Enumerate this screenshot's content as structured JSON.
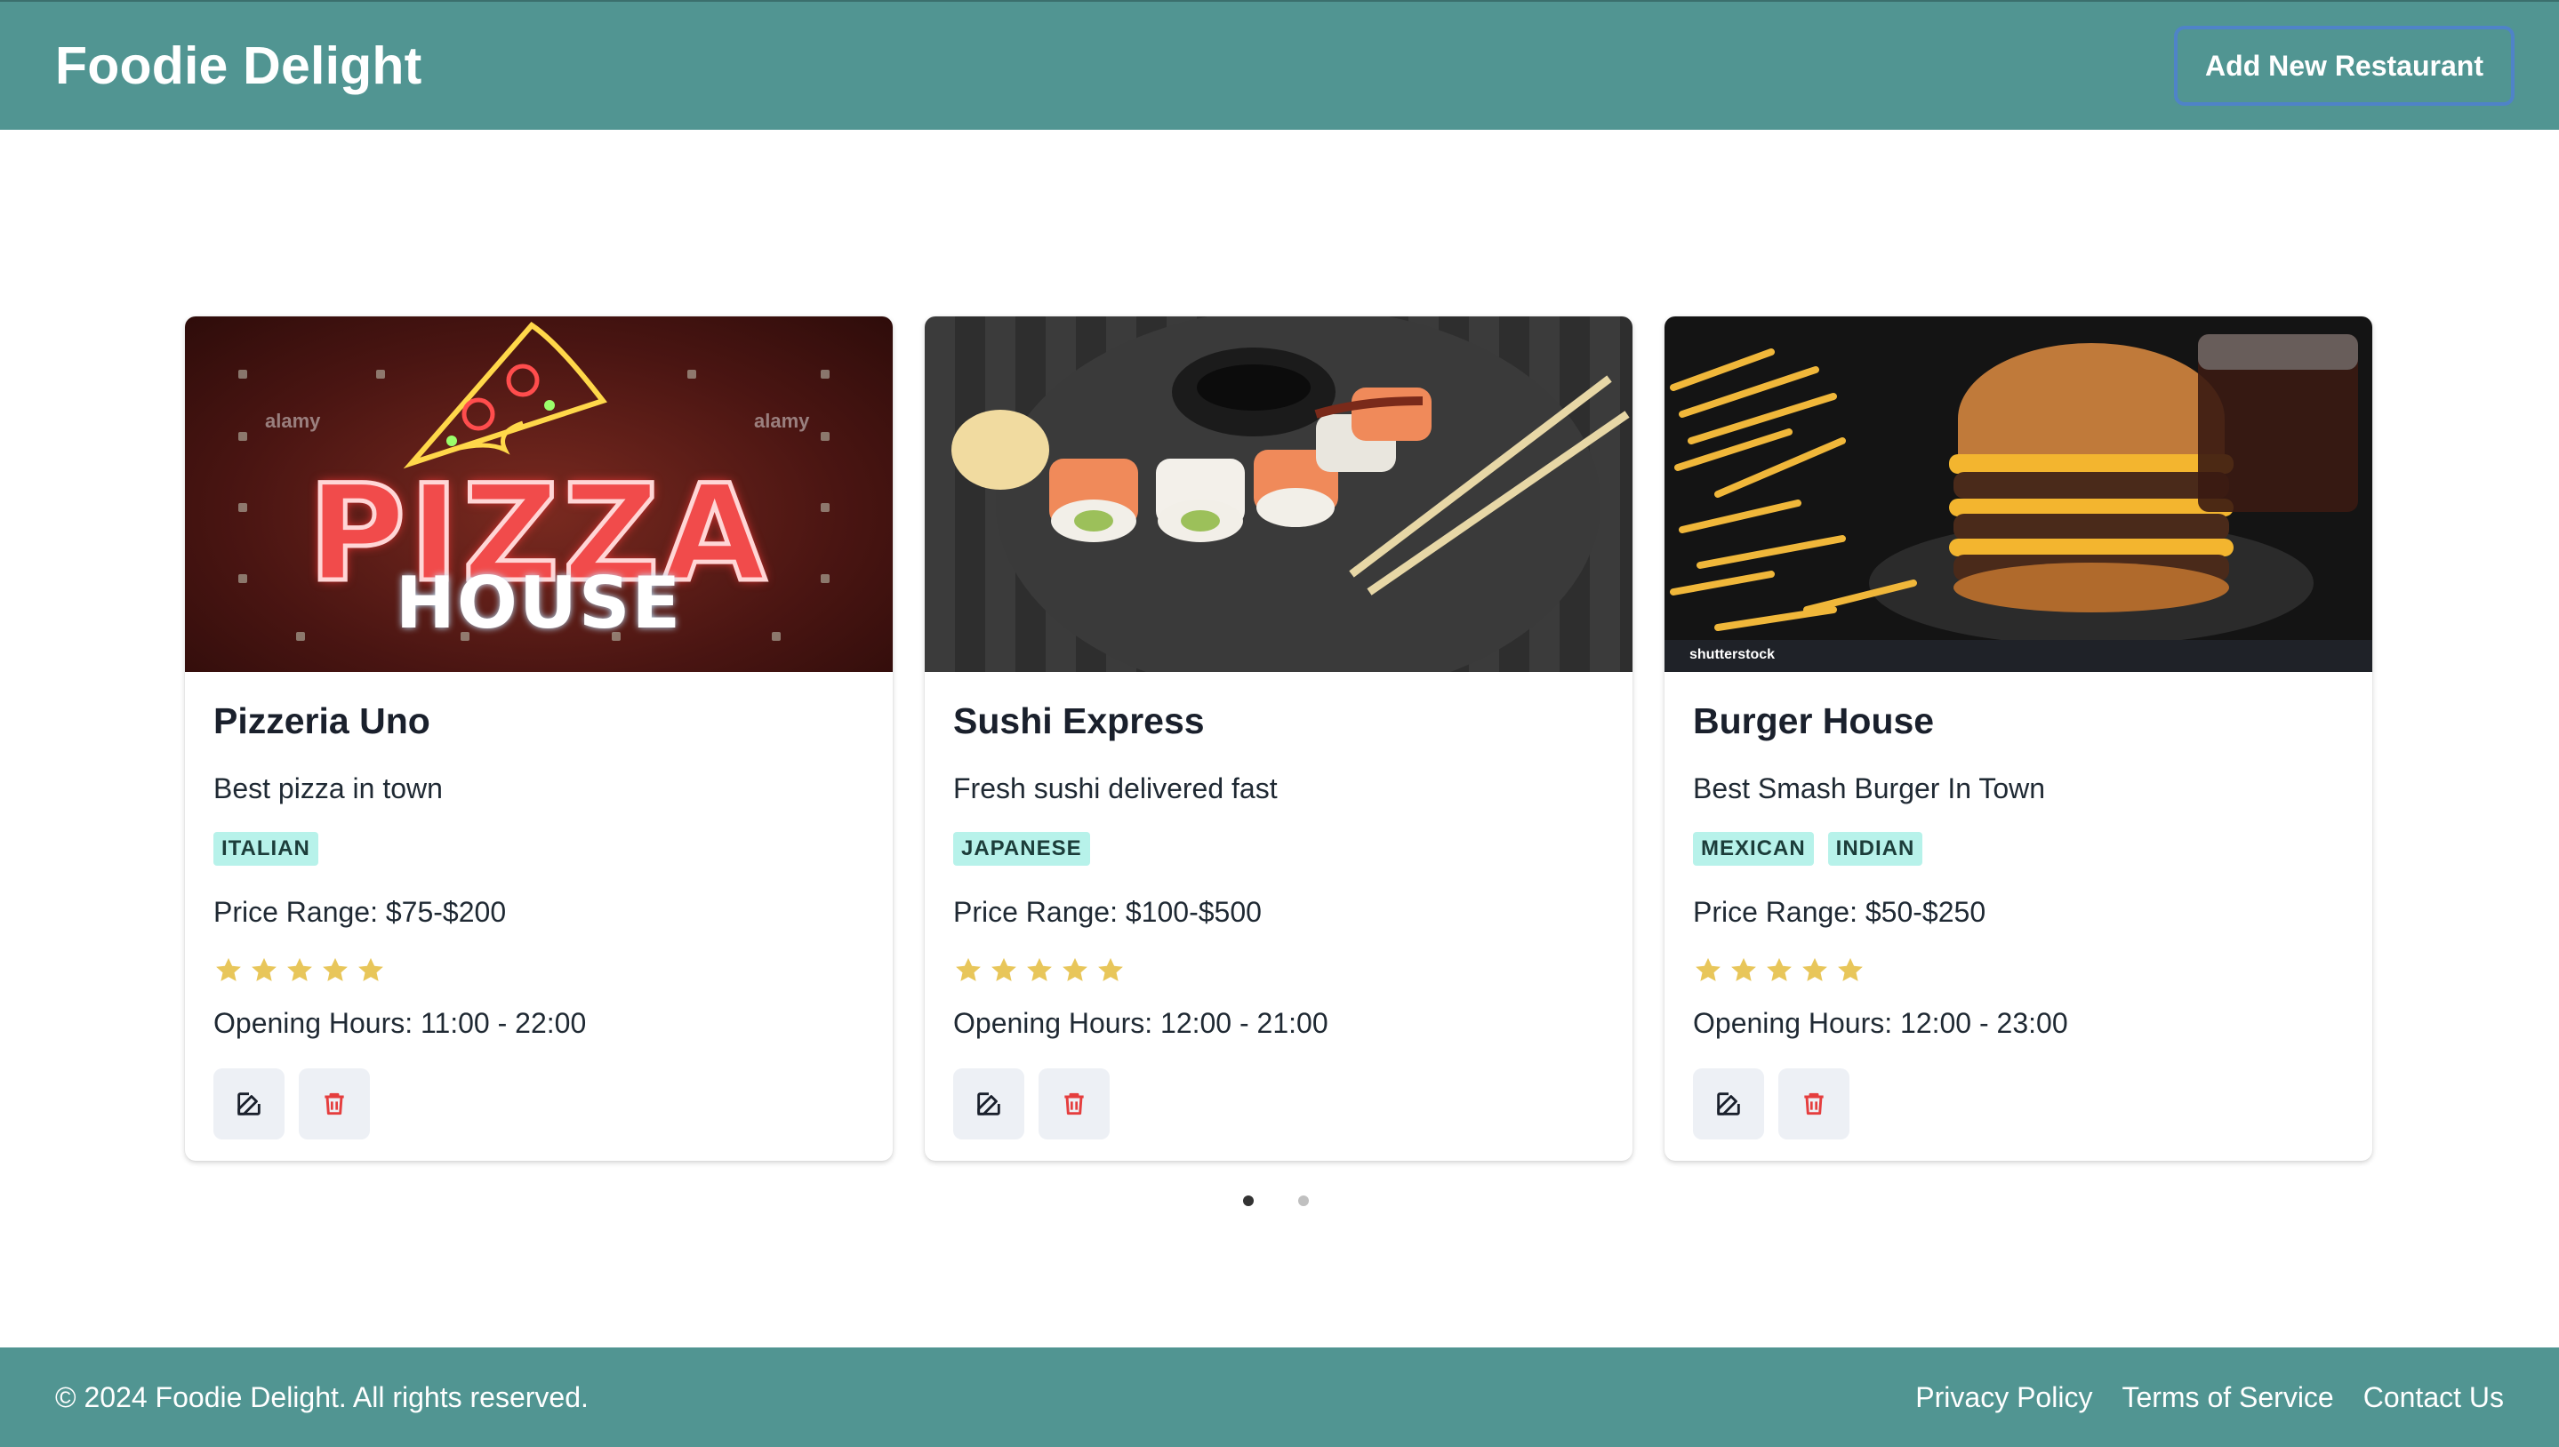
{
  "colors": {
    "brand": "#519592",
    "tag_bg": "#b7f2ea",
    "star": "#e8c65a",
    "delete": "#e53e3e"
  },
  "header": {
    "title": "Foodie Delight",
    "add_button_label": "Add New Restaurant"
  },
  "restaurants": [
    {
      "name": "Pizzeria Uno",
      "description": "Best pizza in town",
      "tags": [
        "ITALIAN"
      ],
      "price_range": "Price Range: $75-$200",
      "rating": 5,
      "hours": "Opening Hours: 11:00 - 22:00",
      "image": {
        "title": "PIZZA",
        "subtitle": "HOUSE",
        "watermark": "alamy"
      }
    },
    {
      "name": "Sushi Express",
      "description": "Fresh sushi delivered fast",
      "tags": [
        "JAPANESE"
      ],
      "price_range": "Price Range: $100-$500",
      "rating": 5,
      "hours": "Opening Hours: 12:00 - 21:00",
      "image": {}
    },
    {
      "name": "Burger House",
      "description": "Best Smash Burger In Town",
      "tags": [
        "MEXICAN",
        "INDIAN"
      ],
      "price_range": "Price Range: $50-$250",
      "rating": 5,
      "hours": "Opening Hours: 12:00 - 23:00",
      "image": {
        "watermark": "shutterstock"
      }
    }
  ],
  "pagination": {
    "current": 1,
    "total": 2
  },
  "footer": {
    "copyright": "© 2024 Foodie Delight. All rights reserved.",
    "links": [
      "Privacy Policy",
      "Terms of Service",
      "Contact Us"
    ]
  },
  "icons": {
    "edit": "edit-icon",
    "delete": "trash-icon",
    "star": "star-icon"
  }
}
